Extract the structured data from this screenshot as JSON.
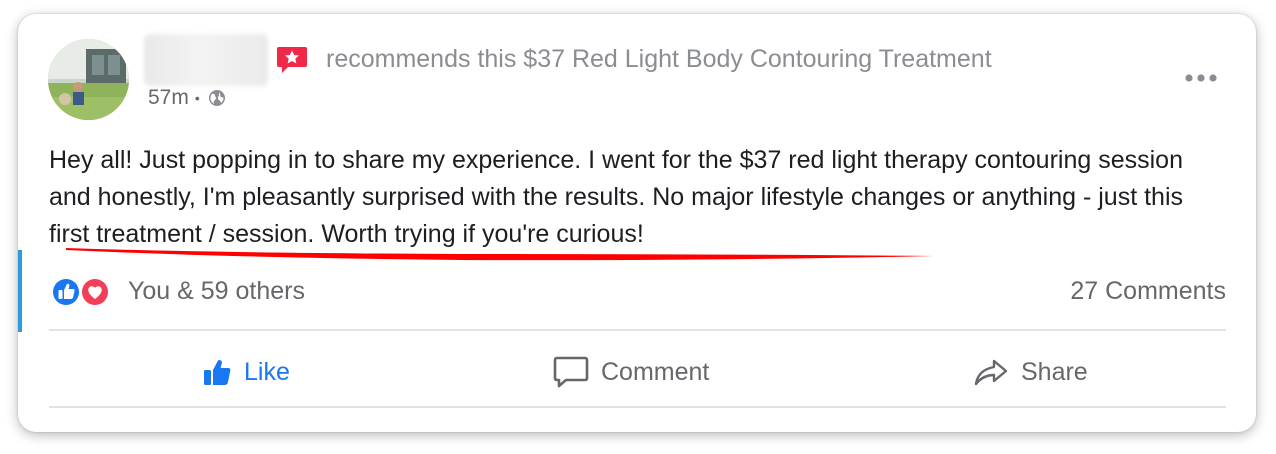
{
  "post": {
    "recommendation": "recommends this $37 Red Light Body Contouring Treatment",
    "time": "57m",
    "separator": "•",
    "audience_icon": "globe-icon",
    "body": "Hey all! Just popping in to share my experience. I went for the $37 red light therapy contouring session and honestly, I'm pleasantly surprised with the results. No major lifestyle changes or anything - just this first treatment / session. Worth trying if you're curious!"
  },
  "engagement": {
    "reactions": [
      "like-reaction-icon",
      "love-reaction-icon"
    ],
    "likes_text": "You & 59 others",
    "comments_text": "27 Comments"
  },
  "actions": {
    "like_label": "Like",
    "comment_label": "Comment",
    "share_label": "Share"
  },
  "colors": {
    "accent_blue": "#1877f2",
    "underline_red": "#ff0000",
    "recommend_badge": "#f02849",
    "love_red": "#f33e58",
    "muted_text": "#65676b"
  }
}
